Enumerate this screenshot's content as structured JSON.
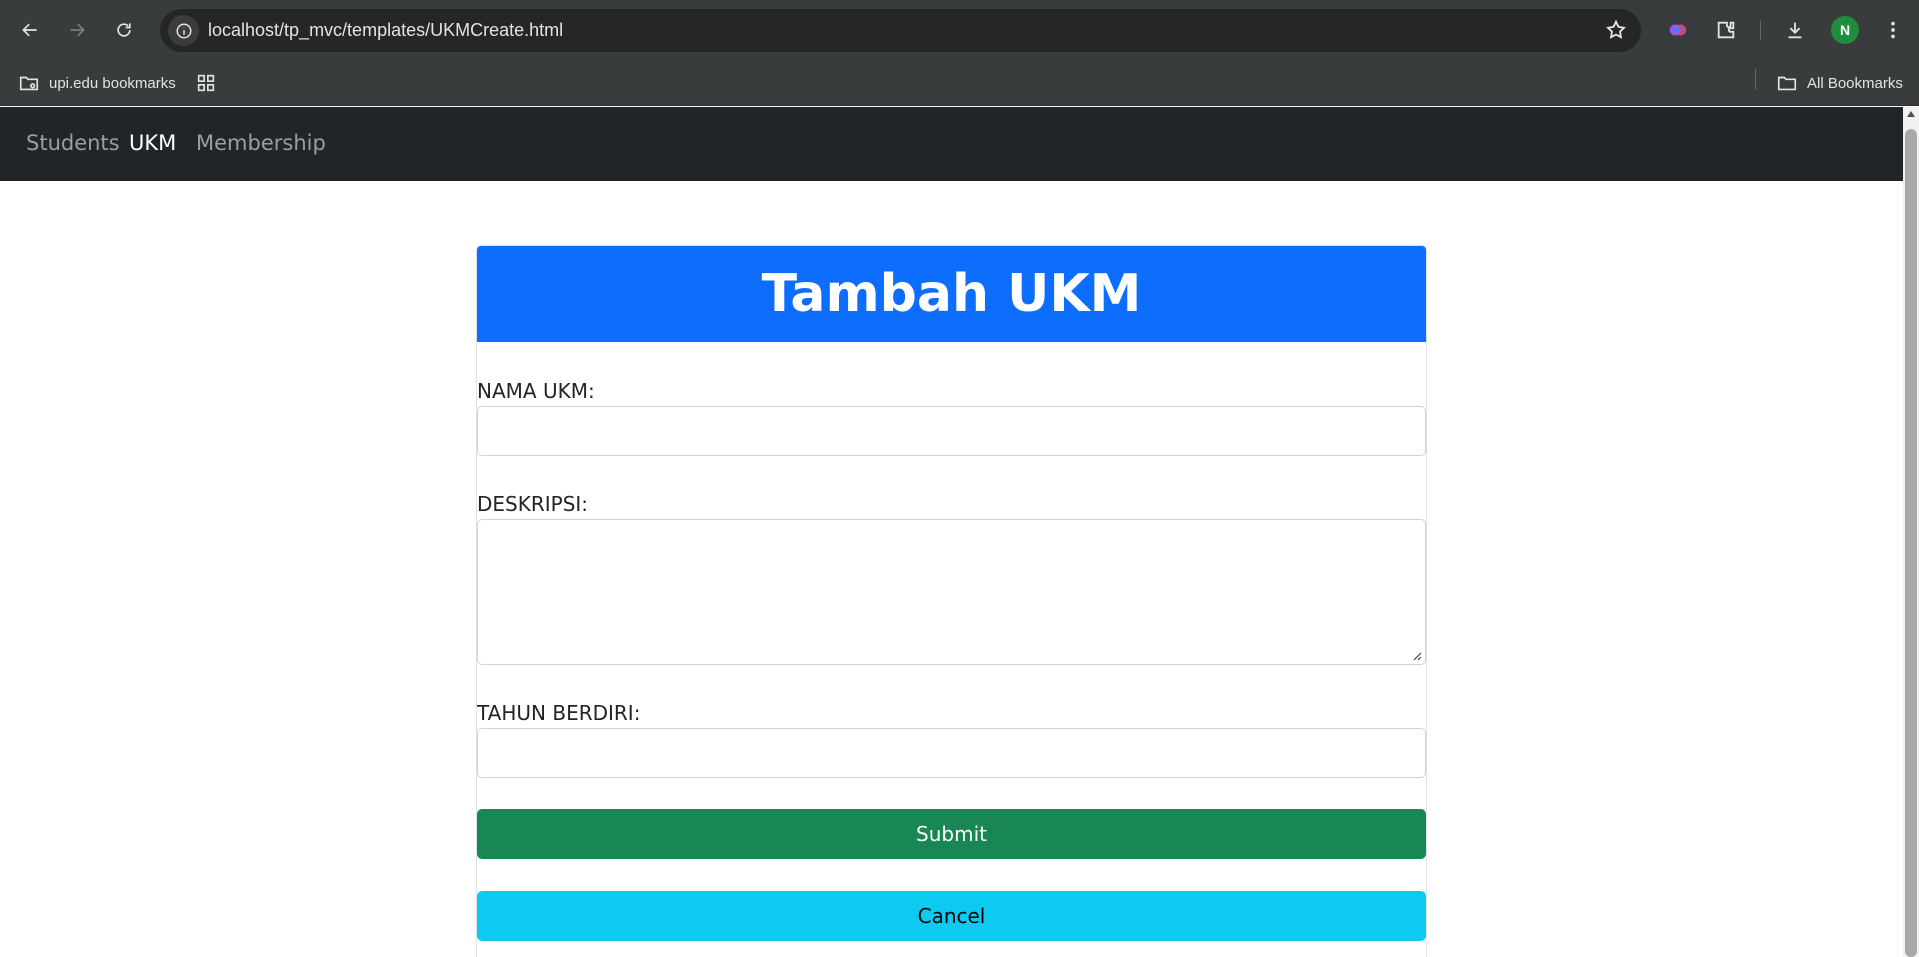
{
  "browser": {
    "url": "localhost/tp_mvc/templates/UKMCreate.html",
    "profile_initial": "N",
    "bookmarks": {
      "folder_label": "upi.edu bookmarks",
      "all_label": "All Bookmarks"
    }
  },
  "navbar": {
    "items": [
      {
        "label": "Students",
        "active": false
      },
      {
        "label": "UKM",
        "active": true
      },
      {
        "label": "Membership",
        "active": false
      }
    ]
  },
  "form": {
    "title": "Tambah UKM",
    "nama_label": "NAMA UKM:",
    "nama_value": "",
    "deskripsi_label": "DESKRIPSI:",
    "deskripsi_value": "",
    "tahun_label": "TAHUN BERDIRI:",
    "tahun_value": "",
    "submit_label": "Submit",
    "cancel_label": "Cancel"
  },
  "colors": {
    "header": "#0d6efd",
    "submit": "#198754",
    "cancel": "#0dcaf0",
    "navbar": "#212529"
  }
}
